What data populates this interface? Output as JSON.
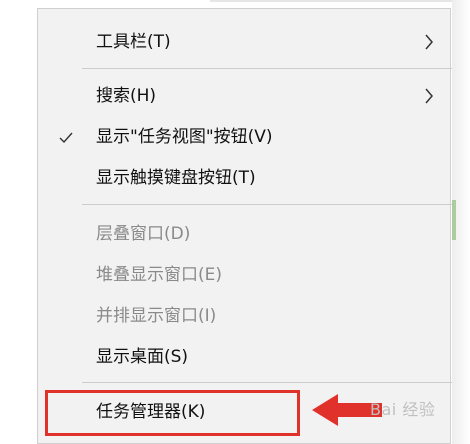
{
  "menu": {
    "items": [
      {
        "label": "工具栏(T)",
        "submenu": true,
        "enabled": true
      },
      {
        "label": "搜索(H)",
        "submenu": true,
        "enabled": true
      },
      {
        "label": "显示\"任务视图\"按钮(V)",
        "checked": true,
        "enabled": true
      },
      {
        "label": "显示触摸键盘按钮(T)",
        "enabled": true
      },
      {
        "label": "层叠窗口(D)",
        "enabled": false
      },
      {
        "label": "堆叠显示窗口(E)",
        "enabled": false
      },
      {
        "label": "并排显示窗口(I)",
        "enabled": false
      },
      {
        "label": "显示桌面(S)",
        "enabled": true
      },
      {
        "label": "任务管理器(K)",
        "enabled": true,
        "highlighted": true
      }
    ]
  },
  "annotation": {
    "highlight_color": "#e0312b",
    "watermark": "Bai 经验"
  },
  "icons": {
    "check": "checkmark-icon",
    "submenu": "chevron-right-icon",
    "arrow": "arrow-left-icon"
  }
}
